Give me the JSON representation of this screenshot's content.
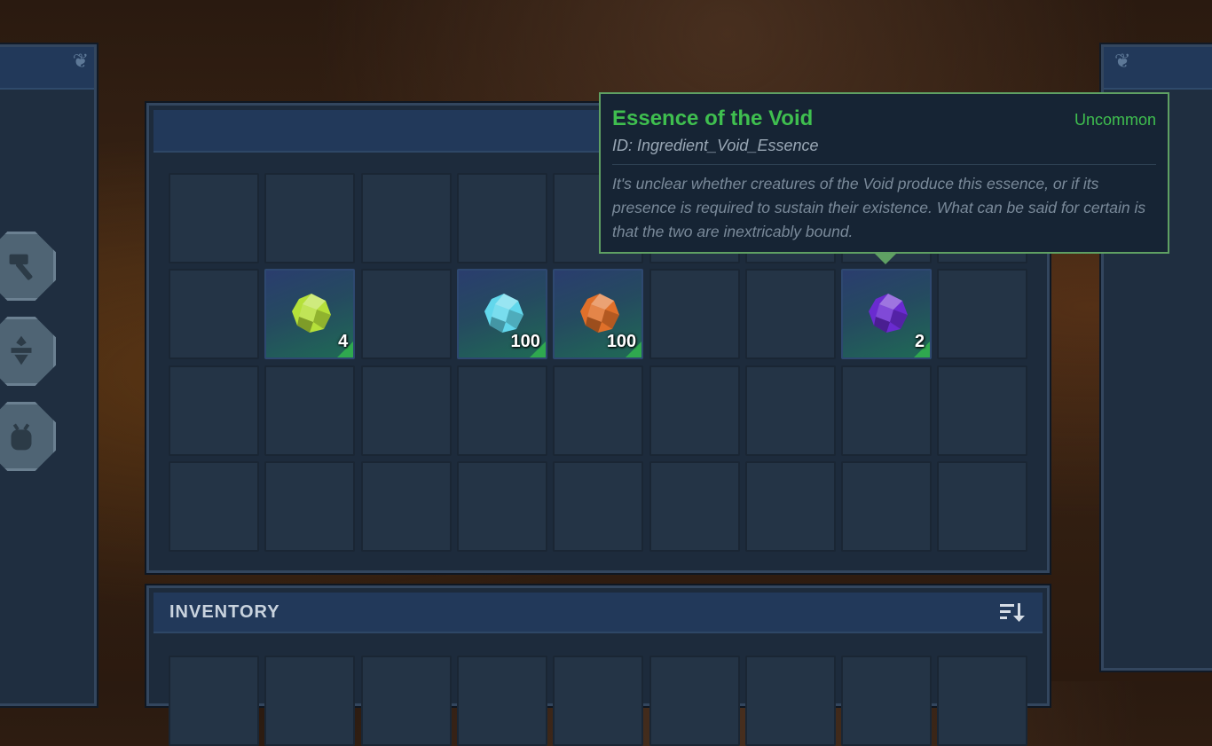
{
  "tooltip": {
    "name": "Essence of the Void",
    "rarity": "Uncommon",
    "id_line": "ID: Ingredient_Void_Essence",
    "description": "It's unclear whether creatures of the Void produce this essence, or if its presence is required to sustain their existence. What can be said for certain is that the two are inextricably bound."
  },
  "chest": {
    "rows": 4,
    "cols": 9,
    "items": [
      {
        "slot": 10,
        "icon": "green-crystal-icon",
        "color": "#b5e03a",
        "quantity": "4"
      },
      {
        "slot": 12,
        "icon": "cyan-crystal-icon",
        "color": "#62d7ec",
        "quantity": "100"
      },
      {
        "slot": 13,
        "icon": "fire-crystal-icon",
        "color": "#e0702a",
        "quantity": "100"
      },
      {
        "slot": 16,
        "icon": "void-crystal-icon",
        "color": "#6a2bd0",
        "quantity": "2"
      }
    ]
  },
  "inventory": {
    "title": "INVENTORY",
    "sort_icon": "sort-icon"
  },
  "nav_tabs": [
    {
      "icon": "hammer-icon"
    },
    {
      "icon": "alchemy-icon"
    },
    {
      "icon": "backpack-icon"
    }
  ],
  "colors": {
    "rarity_uncommon": "#3fbf4f",
    "panel_bg": "#1d2b3c",
    "header_bg": "#22395a",
    "slot_bg": "#243446"
  }
}
